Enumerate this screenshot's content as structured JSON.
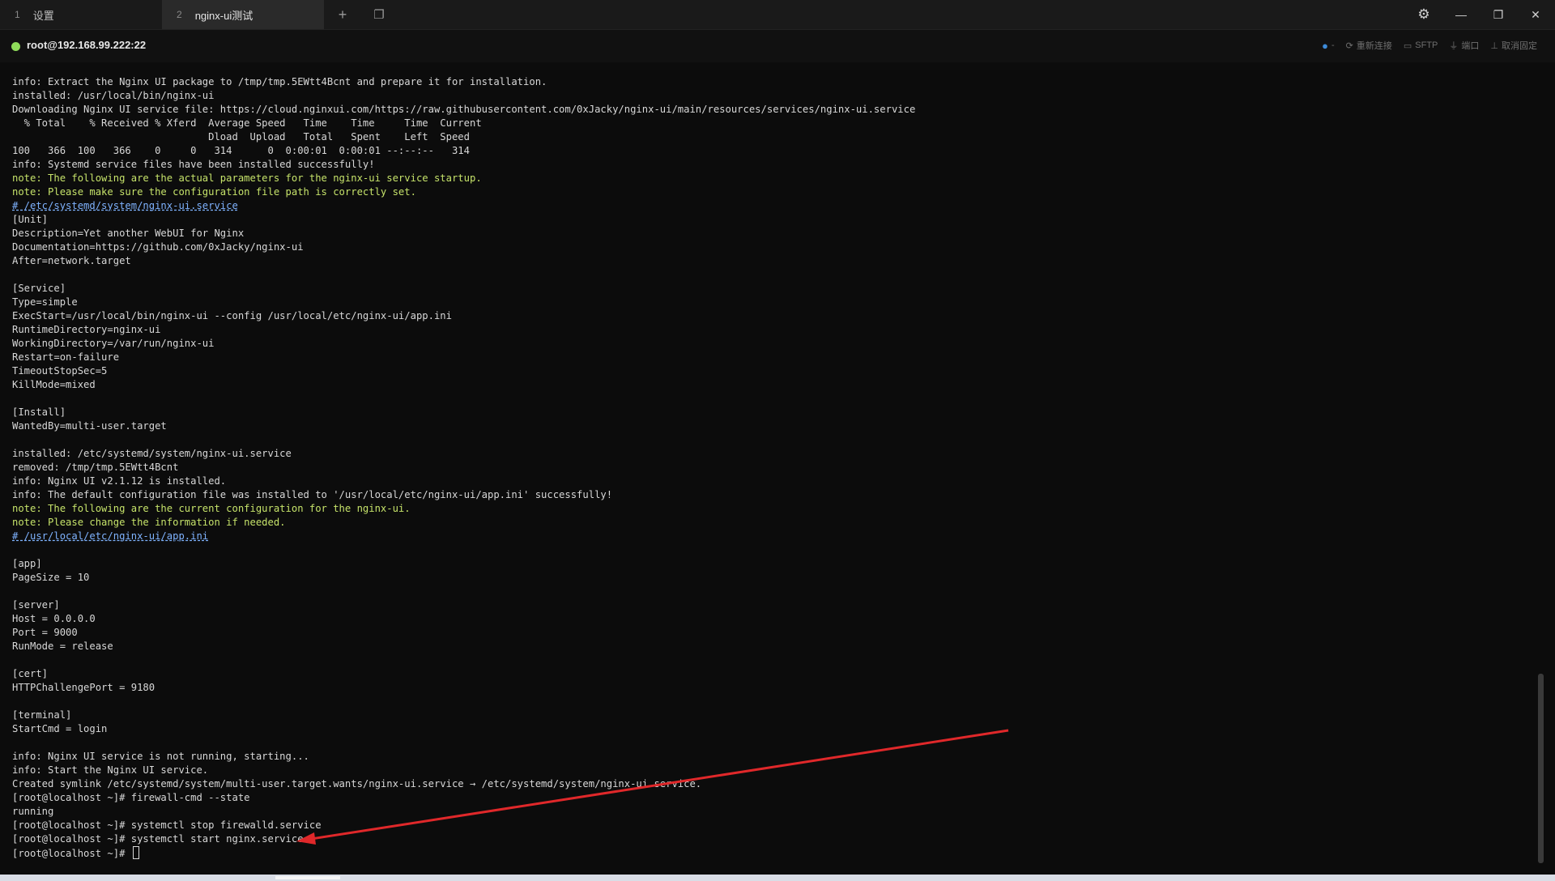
{
  "tabs": [
    {
      "num": "1",
      "label": "设置"
    },
    {
      "num": "2",
      "label": "nginx-ui测试"
    }
  ],
  "tab_controls": {
    "new_tab": "+",
    "tab_overview": "❐"
  },
  "window_controls": {
    "settings": "⚙",
    "minimize": "—",
    "restore": "❐",
    "close": "✕"
  },
  "session": {
    "host": "root@192.168.99.222:22",
    "status_color": "#8fdc5a",
    "tools": {
      "bulb": "💡",
      "bulb_suffix": "-",
      "reconnect": "重新连接",
      "sftp": "SFTP",
      "port": "端口",
      "unpin": "取消固定"
    }
  },
  "terminal": {
    "lines": [
      {
        "text": "info: Extract the Nginx UI package to /tmp/tmp.5EWtt4Bcnt and prepare it for installation.",
        "style": "normal"
      },
      {
        "text": "installed: /usr/local/bin/nginx-ui",
        "style": "normal"
      },
      {
        "text": "Downloading Nginx UI service file: https://cloud.nginxui.com/https://raw.githubusercontent.com/0xJacky/nginx-ui/main/resources/services/nginx-ui.service",
        "style": "normal"
      },
      {
        "text": "  % Total    % Received % Xferd  Average Speed   Time    Time     Time  Current",
        "style": "normal"
      },
      {
        "text": "                                 Dload  Upload   Total   Spent    Left  Speed",
        "style": "normal"
      },
      {
        "text": "100   366  100   366    0     0   314      0  0:00:01  0:00:01 --:--:--   314",
        "style": "normal"
      },
      {
        "text": "info: Systemd service files have been installed successfully!",
        "style": "normal"
      },
      {
        "text": "note: The following are the actual parameters for the nginx-ui service startup.",
        "style": "note"
      },
      {
        "text": "note: Please make sure the configuration file path is correctly set.",
        "style": "note"
      },
      {
        "text": "# /etc/systemd/system/nginx-ui.service",
        "style": "path"
      },
      {
        "text": "[Unit]",
        "style": "normal"
      },
      {
        "text": "Description=Yet another WebUI for Nginx",
        "style": "normal"
      },
      {
        "text": "Documentation=https://github.com/0xJacky/nginx-ui",
        "style": "normal"
      },
      {
        "text": "After=network.target",
        "style": "normal"
      },
      {
        "text": "",
        "style": "normal"
      },
      {
        "text": "[Service]",
        "style": "normal"
      },
      {
        "text": "Type=simple",
        "style": "normal"
      },
      {
        "text": "ExecStart=/usr/local/bin/nginx-ui --config /usr/local/etc/nginx-ui/app.ini",
        "style": "normal"
      },
      {
        "text": "RuntimeDirectory=nginx-ui",
        "style": "normal"
      },
      {
        "text": "WorkingDirectory=/var/run/nginx-ui",
        "style": "normal"
      },
      {
        "text": "Restart=on-failure",
        "style": "normal"
      },
      {
        "text": "TimeoutStopSec=5",
        "style": "normal"
      },
      {
        "text": "KillMode=mixed",
        "style": "normal"
      },
      {
        "text": "",
        "style": "normal"
      },
      {
        "text": "[Install]",
        "style": "normal"
      },
      {
        "text": "WantedBy=multi-user.target",
        "style": "normal"
      },
      {
        "text": "",
        "style": "normal"
      },
      {
        "text": "installed: /etc/systemd/system/nginx-ui.service",
        "style": "normal"
      },
      {
        "text": "removed: /tmp/tmp.5EWtt4Bcnt",
        "style": "normal"
      },
      {
        "text": "info: Nginx UI v2.1.12 is installed.",
        "style": "normal"
      },
      {
        "text": "info: The default configuration file was installed to '/usr/local/etc/nginx-ui/app.ini' successfully!",
        "style": "normal"
      },
      {
        "text": "note: The following are the current configuration for the nginx-ui.",
        "style": "note"
      },
      {
        "text": "note: Please change the information if needed.",
        "style": "note"
      },
      {
        "text": "# /usr/local/etc/nginx-ui/app.ini",
        "style": "path"
      },
      {
        "text": "",
        "style": "normal"
      },
      {
        "text": "[app]",
        "style": "normal"
      },
      {
        "text": "PageSize = 10",
        "style": "normal"
      },
      {
        "text": "",
        "style": "normal"
      },
      {
        "text": "[server]",
        "style": "normal"
      },
      {
        "text": "Host = 0.0.0.0",
        "style": "normal"
      },
      {
        "text": "Port = 9000",
        "style": "normal"
      },
      {
        "text": "RunMode = release",
        "style": "normal"
      },
      {
        "text": "",
        "style": "normal"
      },
      {
        "text": "[cert]",
        "style": "normal"
      },
      {
        "text": "HTTPChallengePort = 9180",
        "style": "normal"
      },
      {
        "text": "",
        "style": "normal"
      },
      {
        "text": "[terminal]",
        "style": "normal"
      },
      {
        "text": "StartCmd = login",
        "style": "normal"
      },
      {
        "text": "",
        "style": "normal"
      },
      {
        "text": "info: Nginx UI service is not running, starting...",
        "style": "normal"
      },
      {
        "text": "info: Start the Nginx UI service.",
        "style": "normal"
      },
      {
        "text": "Created symlink /etc/systemd/system/multi-user.target.wants/nginx-ui.service → /etc/systemd/system/nginx-ui.service.",
        "style": "normal"
      },
      {
        "text": "[root@localhost ~]# firewall-cmd --state",
        "style": "normal"
      },
      {
        "text": "running",
        "style": "normal"
      },
      {
        "text": "[root@localhost ~]# systemctl stop firewalld.service",
        "style": "normal"
      },
      {
        "text": "[root@localhost ~]# systemctl start nginx.service",
        "style": "normal"
      },
      {
        "text": "[root@localhost ~]# ",
        "style": "prompt"
      }
    ]
  },
  "annotation_arrow_color": "#e0282a"
}
